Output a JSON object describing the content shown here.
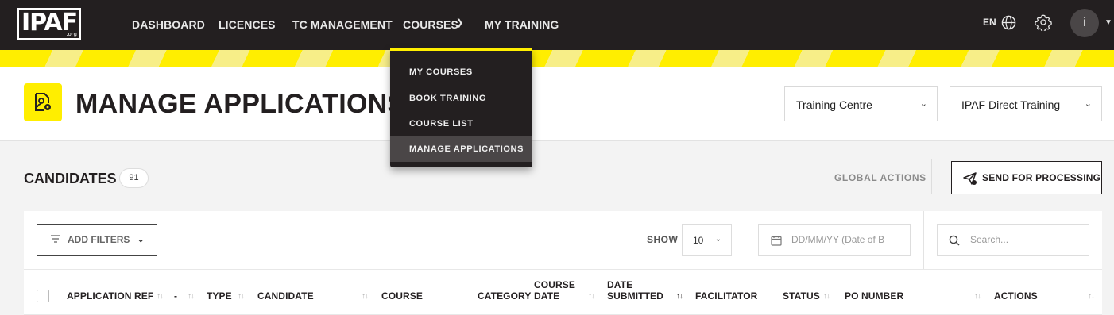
{
  "nav": {
    "logo_text": "IPAF",
    "logo_suffix": ".org",
    "items": [
      "DASHBOARD",
      "LICENCES",
      "TC MANAGEMENT",
      "COURSES",
      "MY TRAINING"
    ],
    "language": "EN",
    "avatar_initial": "i"
  },
  "courses_menu": {
    "items": [
      "MY COURSES",
      "BOOK TRAINING",
      "COURSE LIST",
      "MANAGE APPLICATIONS"
    ],
    "active": "MANAGE APPLICATIONS"
  },
  "header": {
    "title": "MANAGE APPLICATIONS",
    "selects": [
      "Training Centre",
      "IPAF Direct Training"
    ]
  },
  "candidates": {
    "title": "CANDIDATES",
    "count": "91",
    "global_actions": "GLOBAL ACTIONS",
    "send_button": "SEND FOR PROCESSING"
  },
  "toolbar": {
    "add_filters": "ADD FILTERS",
    "show_label": "SHOW",
    "show_value": "10",
    "date_placeholder": "DD/MM/YY (Date of B",
    "search_placeholder": "Search..."
  },
  "table": {
    "columns": [
      {
        "label": "APPLICATION REF"
      },
      {
        "label": "-"
      },
      {
        "label": "TYPE"
      },
      {
        "label": "CANDIDATE"
      },
      {
        "label": "COURSE"
      },
      {
        "label": "CATEGORY"
      },
      {
        "label": "COURSE\nDATE"
      },
      {
        "label": "DATE\nSUBMITTED"
      },
      {
        "label": "FACILITATOR"
      },
      {
        "label": "STATUS"
      },
      {
        "label": "PO NUMBER"
      },
      {
        "label": "ACTIONS"
      }
    ]
  },
  "colors": {
    "brand_yellow": "#ffee00",
    "dark": "#231f20"
  }
}
